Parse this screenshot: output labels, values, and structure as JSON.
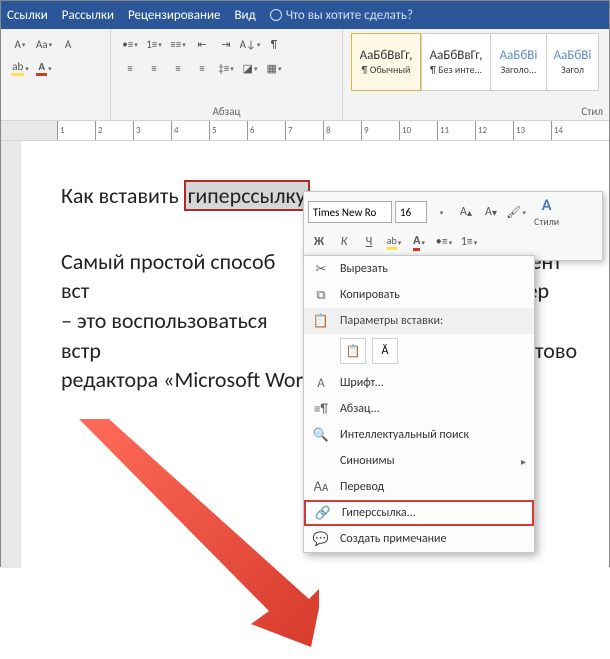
{
  "tabs": [
    "Ссылки",
    "Рассылки",
    "Рецензирование",
    "Вид"
  ],
  "tell_me": "Что вы хотите сделать?",
  "ribbon": {
    "paragraph_label": "Абзац",
    "styles_label": "Стил",
    "styles": [
      {
        "sample": "АаБбВвГг,",
        "name": "¶ Обычный"
      },
      {
        "sample": "АаБбВвГг,",
        "name": "¶ Без инте..."
      },
      {
        "sample": "АаБбВі",
        "name": "Заголо..."
      },
      {
        "sample": "АаБбВі",
        "name": "Загол"
      }
    ]
  },
  "ruler": [
    "1",
    "2",
    "3",
    "4",
    "5",
    "6",
    "7",
    "8",
    "9",
    "10",
    "11",
    "12",
    "13",
    "14"
  ],
  "document": {
    "para1_a": "Как вставить ",
    "para1_sel": "гиперссылку",
    "para2_l1": "Самый простой способ вст",
    "para2_r1": "кумент гипер",
    "para2_l2": "– это воспользоваться встр",
    "para2_r2": "ами текстово",
    "para2_l3": "редактора «Microsoft Word"
  },
  "mini": {
    "font": "Times New Ro",
    "size": "16",
    "styles_label": "Стили",
    "bold": "Ж",
    "italic": "К",
    "underline": "Ч"
  },
  "ctx": {
    "cut": "Вырезать",
    "copy": "Копировать",
    "paste_header": "Параметры вставки:",
    "font": "Шрифт...",
    "para": "Абзац...",
    "smart": "Интеллектуальный поиск",
    "syn": "Синонимы",
    "trans": "Перевод",
    "hyper": "Гиперссылка...",
    "comment": "Создать примечание"
  }
}
